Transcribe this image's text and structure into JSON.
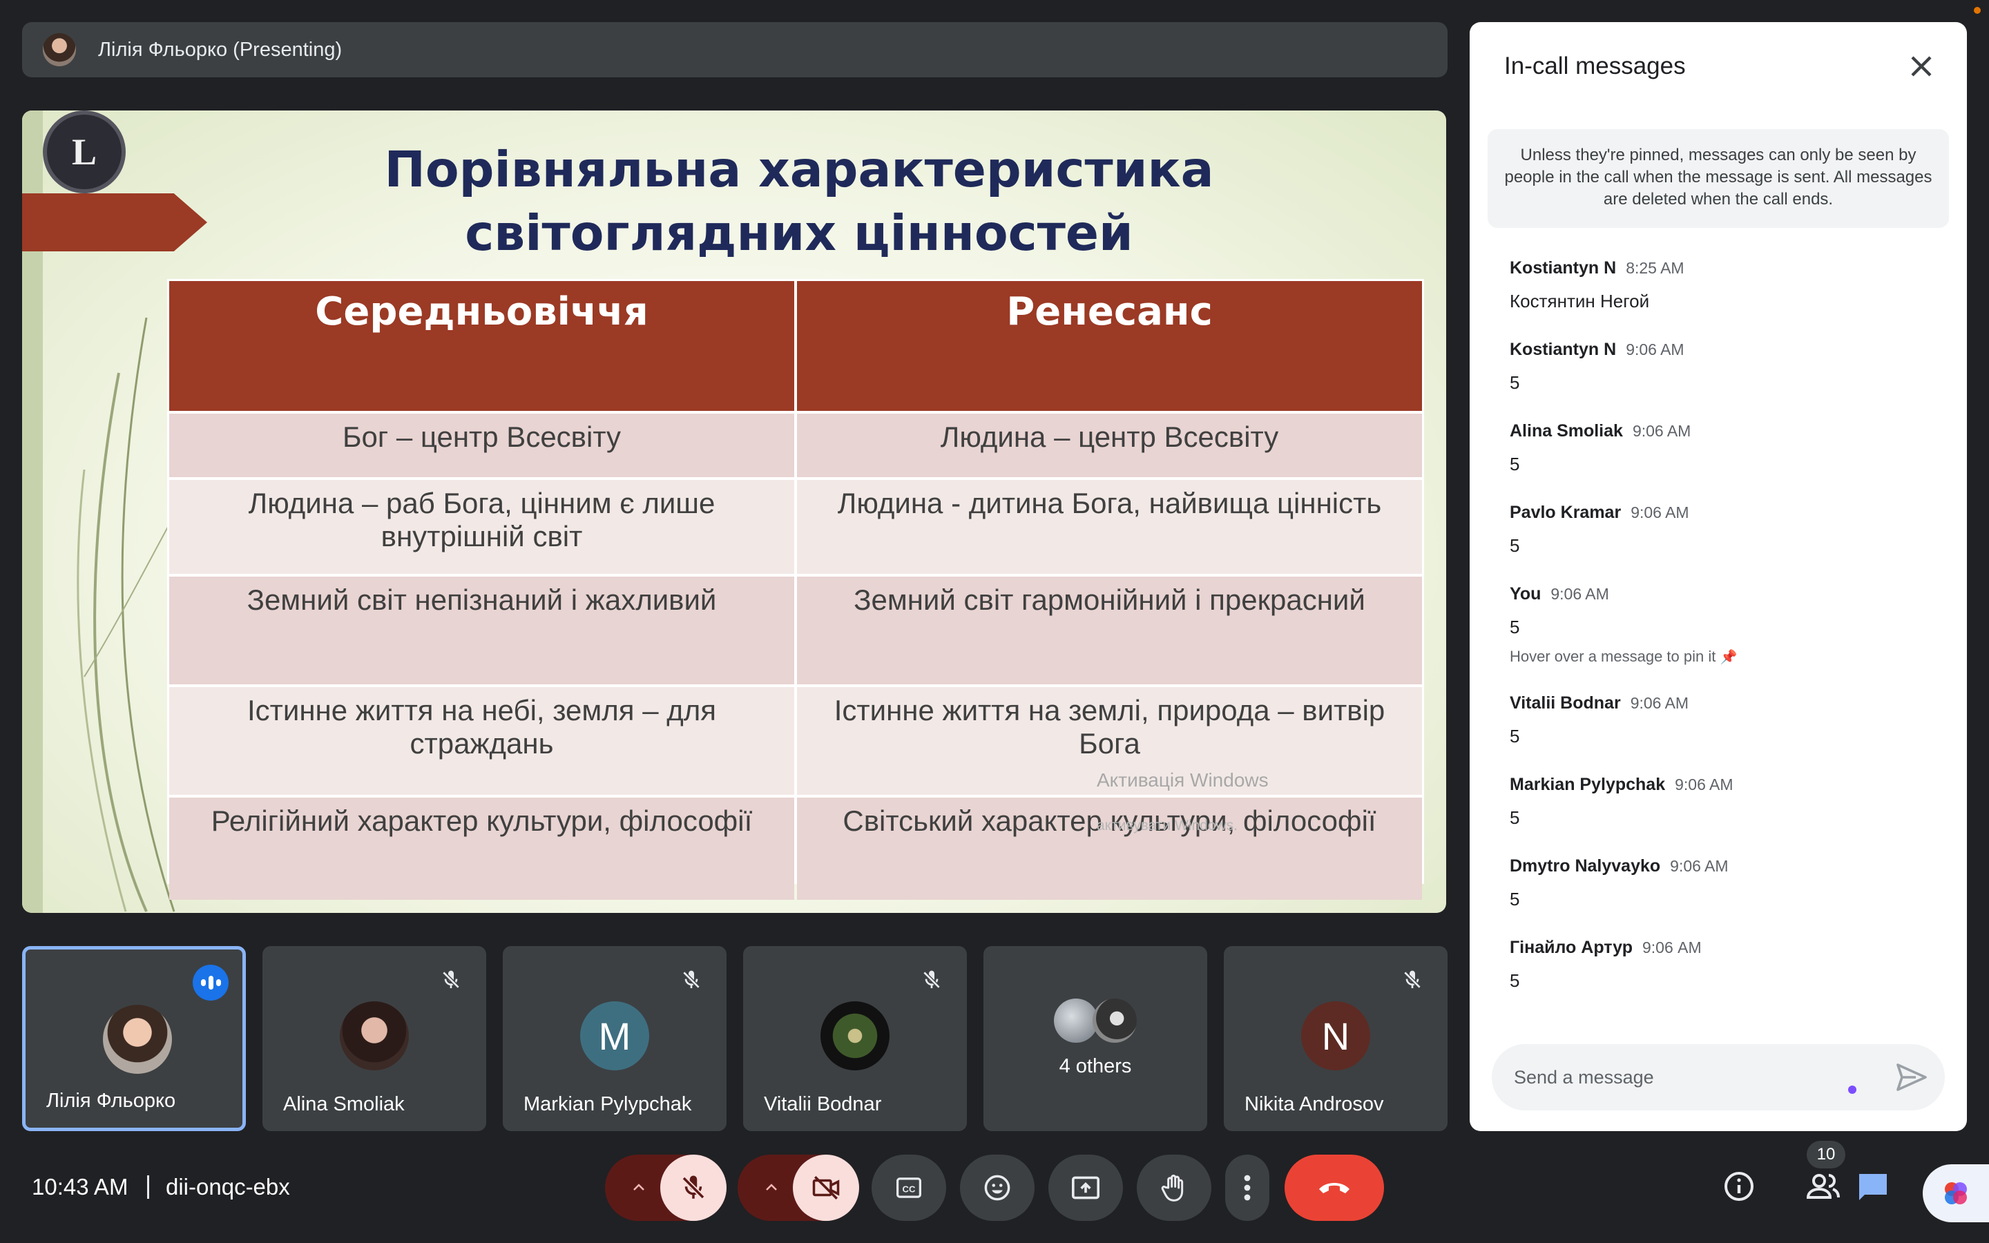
{
  "presenter_bar": {
    "label": "Лілія Фльорко (Presenting)"
  },
  "slide": {
    "logo_letter": "L",
    "title_line1": "Порівняльна характеристика",
    "title_line2": "світоглядних цінностей",
    "table": {
      "headers": [
        "Середньовіччя",
        "Ренесанс"
      ],
      "rows": [
        [
          "Бог – центр Всесвіту",
          "Людина – центр Всесвіту"
        ],
        [
          "Людина – раб Бога, цінним є лише внутрішній світ",
          "Людина  - дитина Бога, найвища цінність"
        ],
        [
          "Земний світ непізнаний і жахливий",
          "Земний світ гармонійний і прекрасний"
        ],
        [
          "Істинне життя на небі, земля – для страждань",
          "Істинне життя на землі, природа – витвір Бога"
        ],
        [
          "Релігійний характер культури, філософії",
          "Світський характер культури, філософії"
        ]
      ]
    },
    "watermark_line1": "Активація Windows",
    "watermark_line2": "активувати Windows."
  },
  "participants": [
    {
      "name": "Лілія Фльорко",
      "speaking": true
    },
    {
      "name": "Alina Smoliak",
      "muted": true
    },
    {
      "name": "Markian Pylypchak",
      "initial": "M",
      "muted": true
    },
    {
      "name": "Vitalii Bodnar",
      "muted": true
    },
    {
      "name": "4 others"
    },
    {
      "name": "Nikita Androsov",
      "initial": "N",
      "muted": true
    }
  ],
  "chat": {
    "title": "In-call messages",
    "notice": "Unless they're pinned, messages can only be seen by people in the call when the message is sent. All messages are deleted when the call ends.",
    "messages": [
      {
        "sender": "Kostiantyn N",
        "time": "8:25 AM",
        "text": "Костянтин Негой"
      },
      {
        "sender": "Kostiantyn N",
        "time": "9:06 AM",
        "text": "5"
      },
      {
        "sender": "Alina Smoliak",
        "time": "9:06 AM",
        "text": "5"
      },
      {
        "sender": "Pavlo Kramar",
        "time": "9:06 AM",
        "text": "5"
      },
      {
        "sender": "You",
        "time": "9:06 AM",
        "text": "5",
        "hint": "Hover over a message to pin it"
      },
      {
        "sender": "Vitalii Bodnar",
        "time": "9:06 AM",
        "text": "5"
      },
      {
        "sender": "Markian Pylypchak",
        "time": "9:06 AM",
        "text": "5"
      },
      {
        "sender": "Dmytro Nalyvayko",
        "time": "9:06 AM",
        "text": "5"
      },
      {
        "sender": "Гінайло Артур",
        "time": "9:06 AM",
        "text": "5"
      }
    ],
    "input_placeholder": "Send a message"
  },
  "bottom": {
    "time": "10:43 AM",
    "meeting_code": "dii-onqc-ebx",
    "people_count": "10"
  },
  "colors": {
    "end_call": "#ea4335",
    "muted_control_bg": "#f9dedc",
    "muted_control_dark": "#5c1a17",
    "accent": "#8ab4f8",
    "slide_header": "#9b3a25",
    "slide_title": "#1f2a5a"
  },
  "icons": [
    "mic-off-icon",
    "camera-off-icon",
    "captions-icon",
    "emoji-icon",
    "present-icon",
    "raise-hand-icon",
    "more-icon",
    "end-call-icon",
    "info-icon",
    "people-icon",
    "chat-icon",
    "activities-icon",
    "close-icon",
    "send-icon",
    "pin-icon"
  ]
}
